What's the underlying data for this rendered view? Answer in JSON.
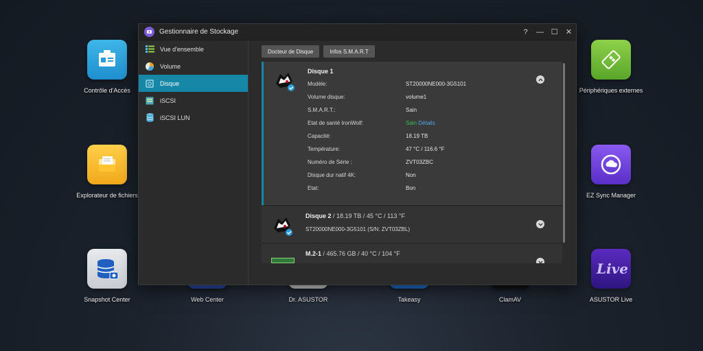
{
  "desktop": {
    "icons": [
      {
        "label": "Contrôle d'Accès"
      },
      {
        "label": "Explorateur de fichiers"
      },
      {
        "label": "Snapshot Center"
      },
      {
        "label": "Web Center"
      },
      {
        "label": "Dr. ASUSTOR"
      },
      {
        "label": "Takeasy"
      },
      {
        "label": "ClamAV"
      },
      {
        "label": "Périphériques externes"
      },
      {
        "label": "EZ Sync Manager"
      },
      {
        "label": "ASUSTOR Live"
      }
    ]
  },
  "window": {
    "title": "Gestionnaire de Stockage",
    "controls": {
      "help": "?",
      "minimize": "—",
      "maximize": "☐",
      "close": "✕"
    }
  },
  "sidebar": {
    "items": [
      {
        "label": "Vue d'ensemble"
      },
      {
        "label": "Volume"
      },
      {
        "label": "Disque"
      },
      {
        "label": "iSCSI"
      },
      {
        "label": "iSCSI LUN"
      }
    ]
  },
  "toolbar": {
    "doctor_label": "Docteur de Disque",
    "smart_label": "Infos S.M.A.R.T"
  },
  "disks": {
    "disk1": {
      "name": "Disque 1",
      "fields": [
        {
          "key": "Modèle:",
          "value": "ST20000NE000-3G5101"
        },
        {
          "key": "Volume disque:",
          "value": "volume1"
        },
        {
          "key": "S.M.A.R.T.:",
          "value": "Sain"
        },
        {
          "key": "Etat de santé IronWolf:",
          "value": "Sain",
          "link": " Détails"
        },
        {
          "key": "Capacité:",
          "value": "18.19 TB"
        },
        {
          "key": "Température:",
          "value": "47 °C / 116.6 °F"
        },
        {
          "key": "Numéro de Série :",
          "value": "ZVT03ZBC"
        },
        {
          "key": "Disque dur natif 4K:",
          "value": "Non"
        },
        {
          "key": "Etat:",
          "value": "Bon"
        }
      ]
    },
    "disk2": {
      "name": "Disque 2",
      "meta": " / 18.19 TB / 45 °C / 113 °F",
      "sub": "ST20000NE000-3G5101 (S/N: ZVT03ZBL)"
    },
    "m2": {
      "name": "M.2-1",
      "meta": " / 465.76 GB / 40 °C / 104 °F"
    }
  },
  "colors": {
    "accent": "#1687a7",
    "healthy": "#3fbf5a",
    "link": "#52a7e8"
  }
}
